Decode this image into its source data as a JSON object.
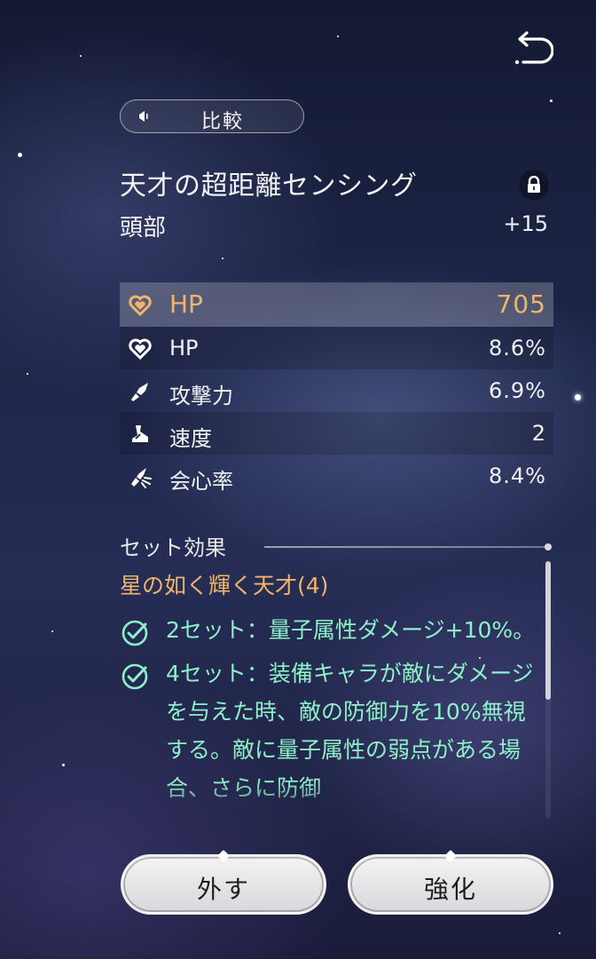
{
  "compare": {
    "label": "比較"
  },
  "item": {
    "name": "天才の超距離センシング",
    "slot": "頭部",
    "level": "+15",
    "locked": true
  },
  "main_stat": {
    "name": "HP",
    "value": "705",
    "icon": "heart-icon",
    "color": "#f0b56a"
  },
  "sub_stats": [
    {
      "name": "HP",
      "value": "8.6%",
      "icon": "heart-icon"
    },
    {
      "name": "攻撃力",
      "value": "6.9%",
      "icon": "sword-icon"
    },
    {
      "name": "速度",
      "value": "2",
      "icon": "boot-icon"
    },
    {
      "name": "会心率",
      "value": "8.4%",
      "icon": "crit-sword-icon"
    }
  ],
  "set_effect": {
    "title": "セット効果",
    "set_name": "星の如く輝く天才(4)",
    "effects": [
      {
        "text": "2セット：量子属性ダメージ+10%。"
      },
      {
        "text": "4セット：装備キャラが敵にダメージを与えた時、敵の防御力を10%無視する。敵に量子属性の弱点がある場合、さらに防御"
      }
    ],
    "effect_color": "#8ef0c8"
  },
  "buttons": {
    "remove": "外す",
    "enhance": "強化"
  }
}
